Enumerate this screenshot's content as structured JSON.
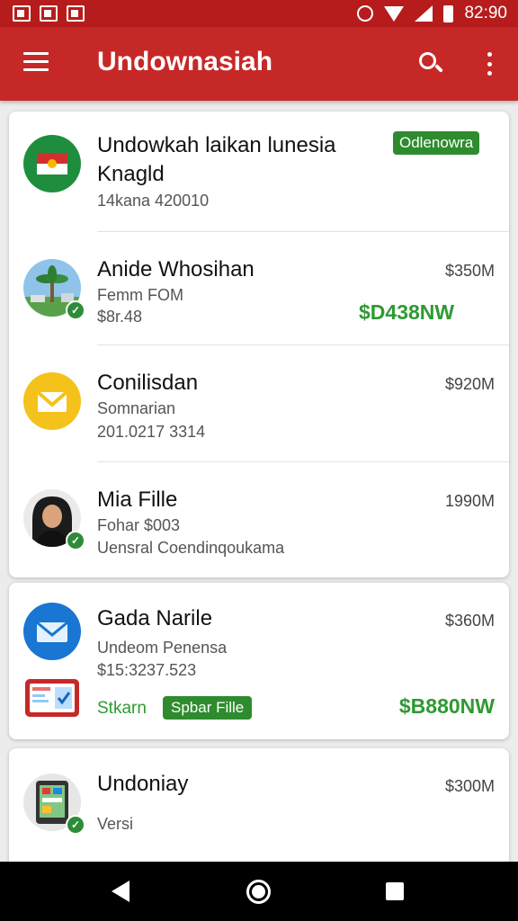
{
  "status_bar": {
    "time": "82:90",
    "left_icons": [
      "notification-icon",
      "gallery-icon",
      "mail-icon"
    ],
    "right_icons": [
      "alarm-icon",
      "wifi-icon",
      "signal-icon",
      "battery-icon"
    ]
  },
  "app_bar": {
    "title": "Undownasiah",
    "color": "#c62828",
    "icons": [
      "menu-icon",
      "search-icon",
      "more-vert-icon"
    ]
  },
  "cards": [
    {
      "rows": [
        {
          "title_line1": "Undowkah laikan lunesia",
          "title_line2": "Knagld",
          "subtitle": "14kana 420010",
          "chip": "Odlenowra",
          "avatar": "flag-icon"
        },
        {
          "title": "Anide Whosihan",
          "subtitle1": "Femm FOM",
          "subtitle2": "$8r.48",
          "amount": "$350M",
          "green_amount": "$D438NW",
          "avatar": "palm-tree-photo"
        },
        {
          "title": "Conilisdan",
          "subtitle1": "Somnarian",
          "subtitle2": "201.0217 3314",
          "amount": "$920M",
          "avatar": "yellow-mail-icon"
        },
        {
          "title": "Mia Fille",
          "subtitle1": "Fohar $003",
          "subtitle2": "Uensral Coendinqoukama",
          "amount": "1990M",
          "avatar": "woman-portrait"
        }
      ]
    },
    {
      "rows": [
        {
          "title": "Gada Narile",
          "subtitle1": "Undeom Penensa",
          "subtitle2": "$15:3237.523",
          "amount": "$360M",
          "link": "Stkarn",
          "chip": "Spbar Fille",
          "green_amount": "$B880NW",
          "avatar": "blue-mail-icon"
        }
      ]
    },
    {
      "rows": [
        {
          "title": "Undoniay",
          "subtitle1": "Versi",
          "amount": "$300M",
          "avatar": "tablet-icon"
        }
      ]
    }
  ],
  "nav_bar": {
    "icons": [
      "back-icon",
      "home-icon",
      "recents-icon"
    ]
  }
}
